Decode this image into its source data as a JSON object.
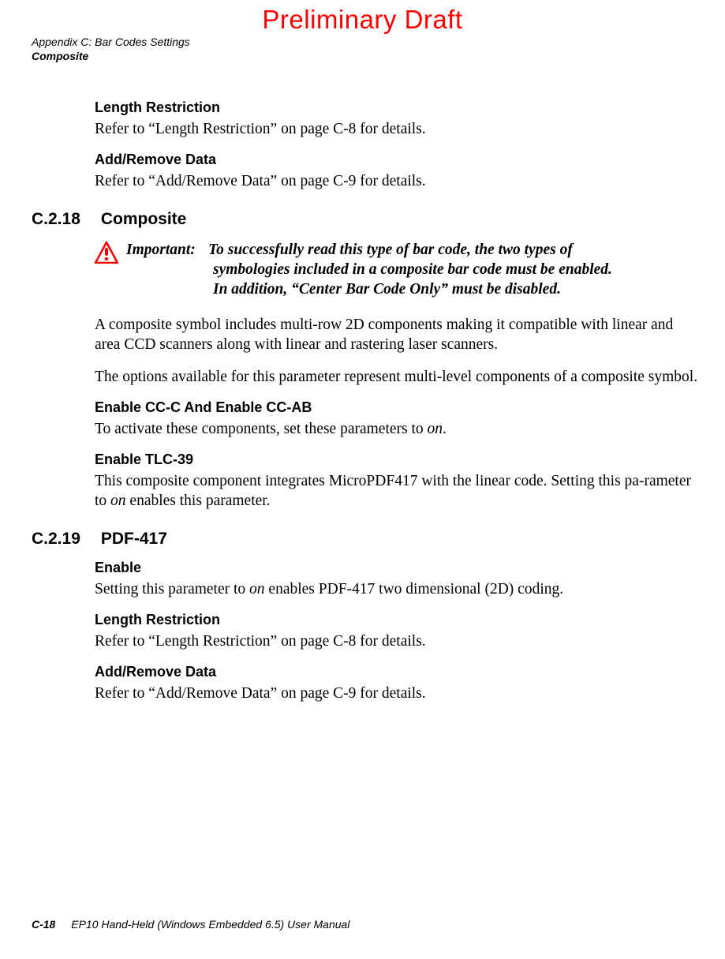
{
  "watermark": "Preliminary Draft",
  "running_header": {
    "line1": "Appendix C: Bar Codes Settings",
    "line2": "Composite"
  },
  "sections": {
    "lr1_title": "Length Restriction",
    "lr1_body": "Refer to “Length Restriction” on page C-8 for details.",
    "ard1_title": "Add/Remove Data",
    "ard1_body": "Refer to “Add/Remove Data” on page C-9 for details.",
    "composite_num": "C.2.18",
    "composite_title": "Composite",
    "important_label": "Important:",
    "important_line1": "To successfully read this type of bar code, the two types of",
    "important_line2": "symbologies included in a composite bar code must be enabled.",
    "important_line3": "In addition, “Center Bar Code Only” must be disabled.",
    "composite_p1": "A composite symbol includes multi-row 2D components making it compatible with linear and area CCD scanners along with linear and rastering laser scanners.",
    "composite_p2": "The options available for this parameter represent multi-level components of a composite symbol.",
    "ccc_title": "Enable CC-C And Enable CC-AB",
    "ccc_body_pre": "To activate these components, set these parameters to ",
    "ccc_body_em": "on",
    "ccc_body_post": ".",
    "tlc_title": "Enable TLC-39",
    "tlc_body_pre": "This composite component integrates MicroPDF417 with the linear code. Setting this pa-rameter to ",
    "tlc_body_em": "on",
    "tlc_body_post": " enables this parameter.",
    "pdf_num": "C.2.19",
    "pdf_title": "PDF-417",
    "enable_title": "Enable",
    "enable_body_pre": "Setting this parameter to ",
    "enable_body_em": "on",
    "enable_body_post": " enables PDF-417 two dimensional (2D) coding.",
    "lr2_title": "Length Restriction",
    "lr2_body": "Refer to “Length Restriction” on page C-8 for details.",
    "ard2_title": "Add/Remove Data",
    "ard2_body": "Refer to “Add/Remove Data” on page C-9 for details."
  },
  "footer": {
    "page_number": "C-18",
    "manual_title": "EP10 Hand-Held (Windows Embedded 6.5) User Manual"
  }
}
